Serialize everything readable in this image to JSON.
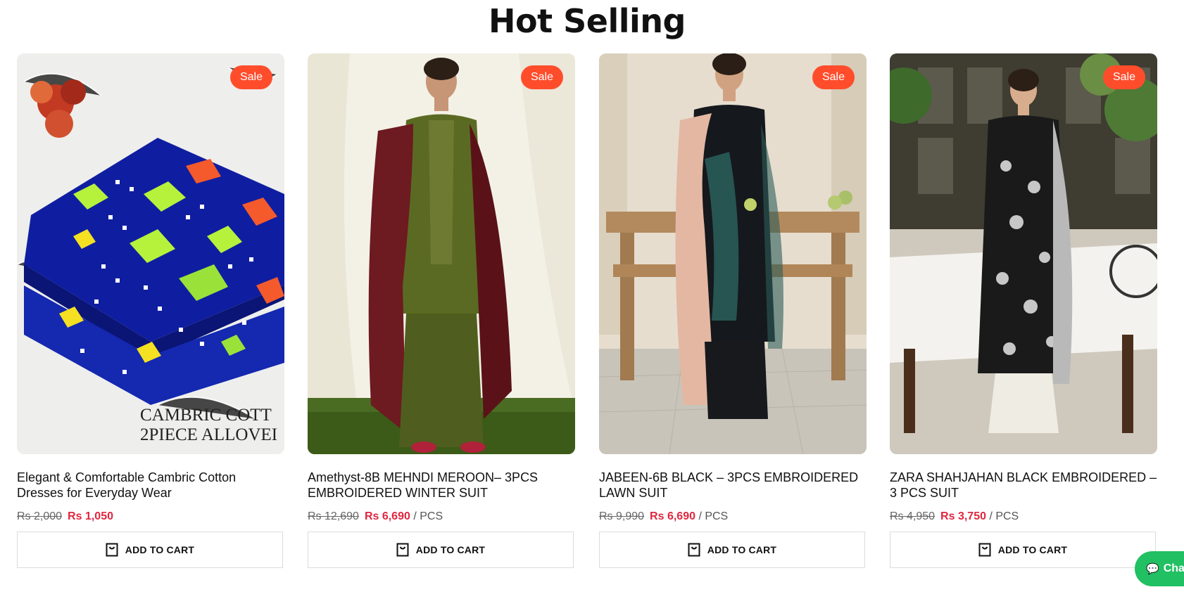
{
  "section": {
    "title": "Hot Selling"
  },
  "products": [
    {
      "name": "Elegant & Comfortable Cambric Cotton Dresses for Everyday Wear",
      "old_price": "Rs 2,000",
      "new_price": "Rs 1,050",
      "unit": "",
      "badge": "Sale",
      "image_text_1": "CAMBRIC COTT",
      "image_text_2": "2PIECE ALLOVEI",
      "cart_label": "ADD TO CART"
    },
    {
      "name": "Amethyst-8B MEHNDI MEROON– 3PCS EMBROIDERED WINTER SUIT",
      "old_price": "Rs 12,690",
      "new_price": "Rs 6,690",
      "unit": "/ PCS",
      "badge": "Sale",
      "cart_label": "ADD TO CART"
    },
    {
      "name": "JABEEN-6B BLACK – 3PCS EMBROIDERED LAWN SUIT",
      "old_price": "Rs 9,990",
      "new_price": "Rs 6,690",
      "unit": "/ PCS",
      "badge": "Sale",
      "cart_label": "ADD TO CART"
    },
    {
      "name": "ZARA SHAHJAHAN BLACK EMBROIDERED – 3 PCS SUIT",
      "old_price": "Rs 4,950",
      "new_price": "Rs 3,750",
      "unit": "/ PCS",
      "badge": "Sale",
      "cart_label": "ADD TO CART"
    }
  ],
  "chat": {
    "label": "Cha",
    "icon": "chat-bubble-icon"
  },
  "colors": {
    "sale_badge": "#ff4d2c",
    "price_new": "#e0263f",
    "chat": "#21c063"
  }
}
